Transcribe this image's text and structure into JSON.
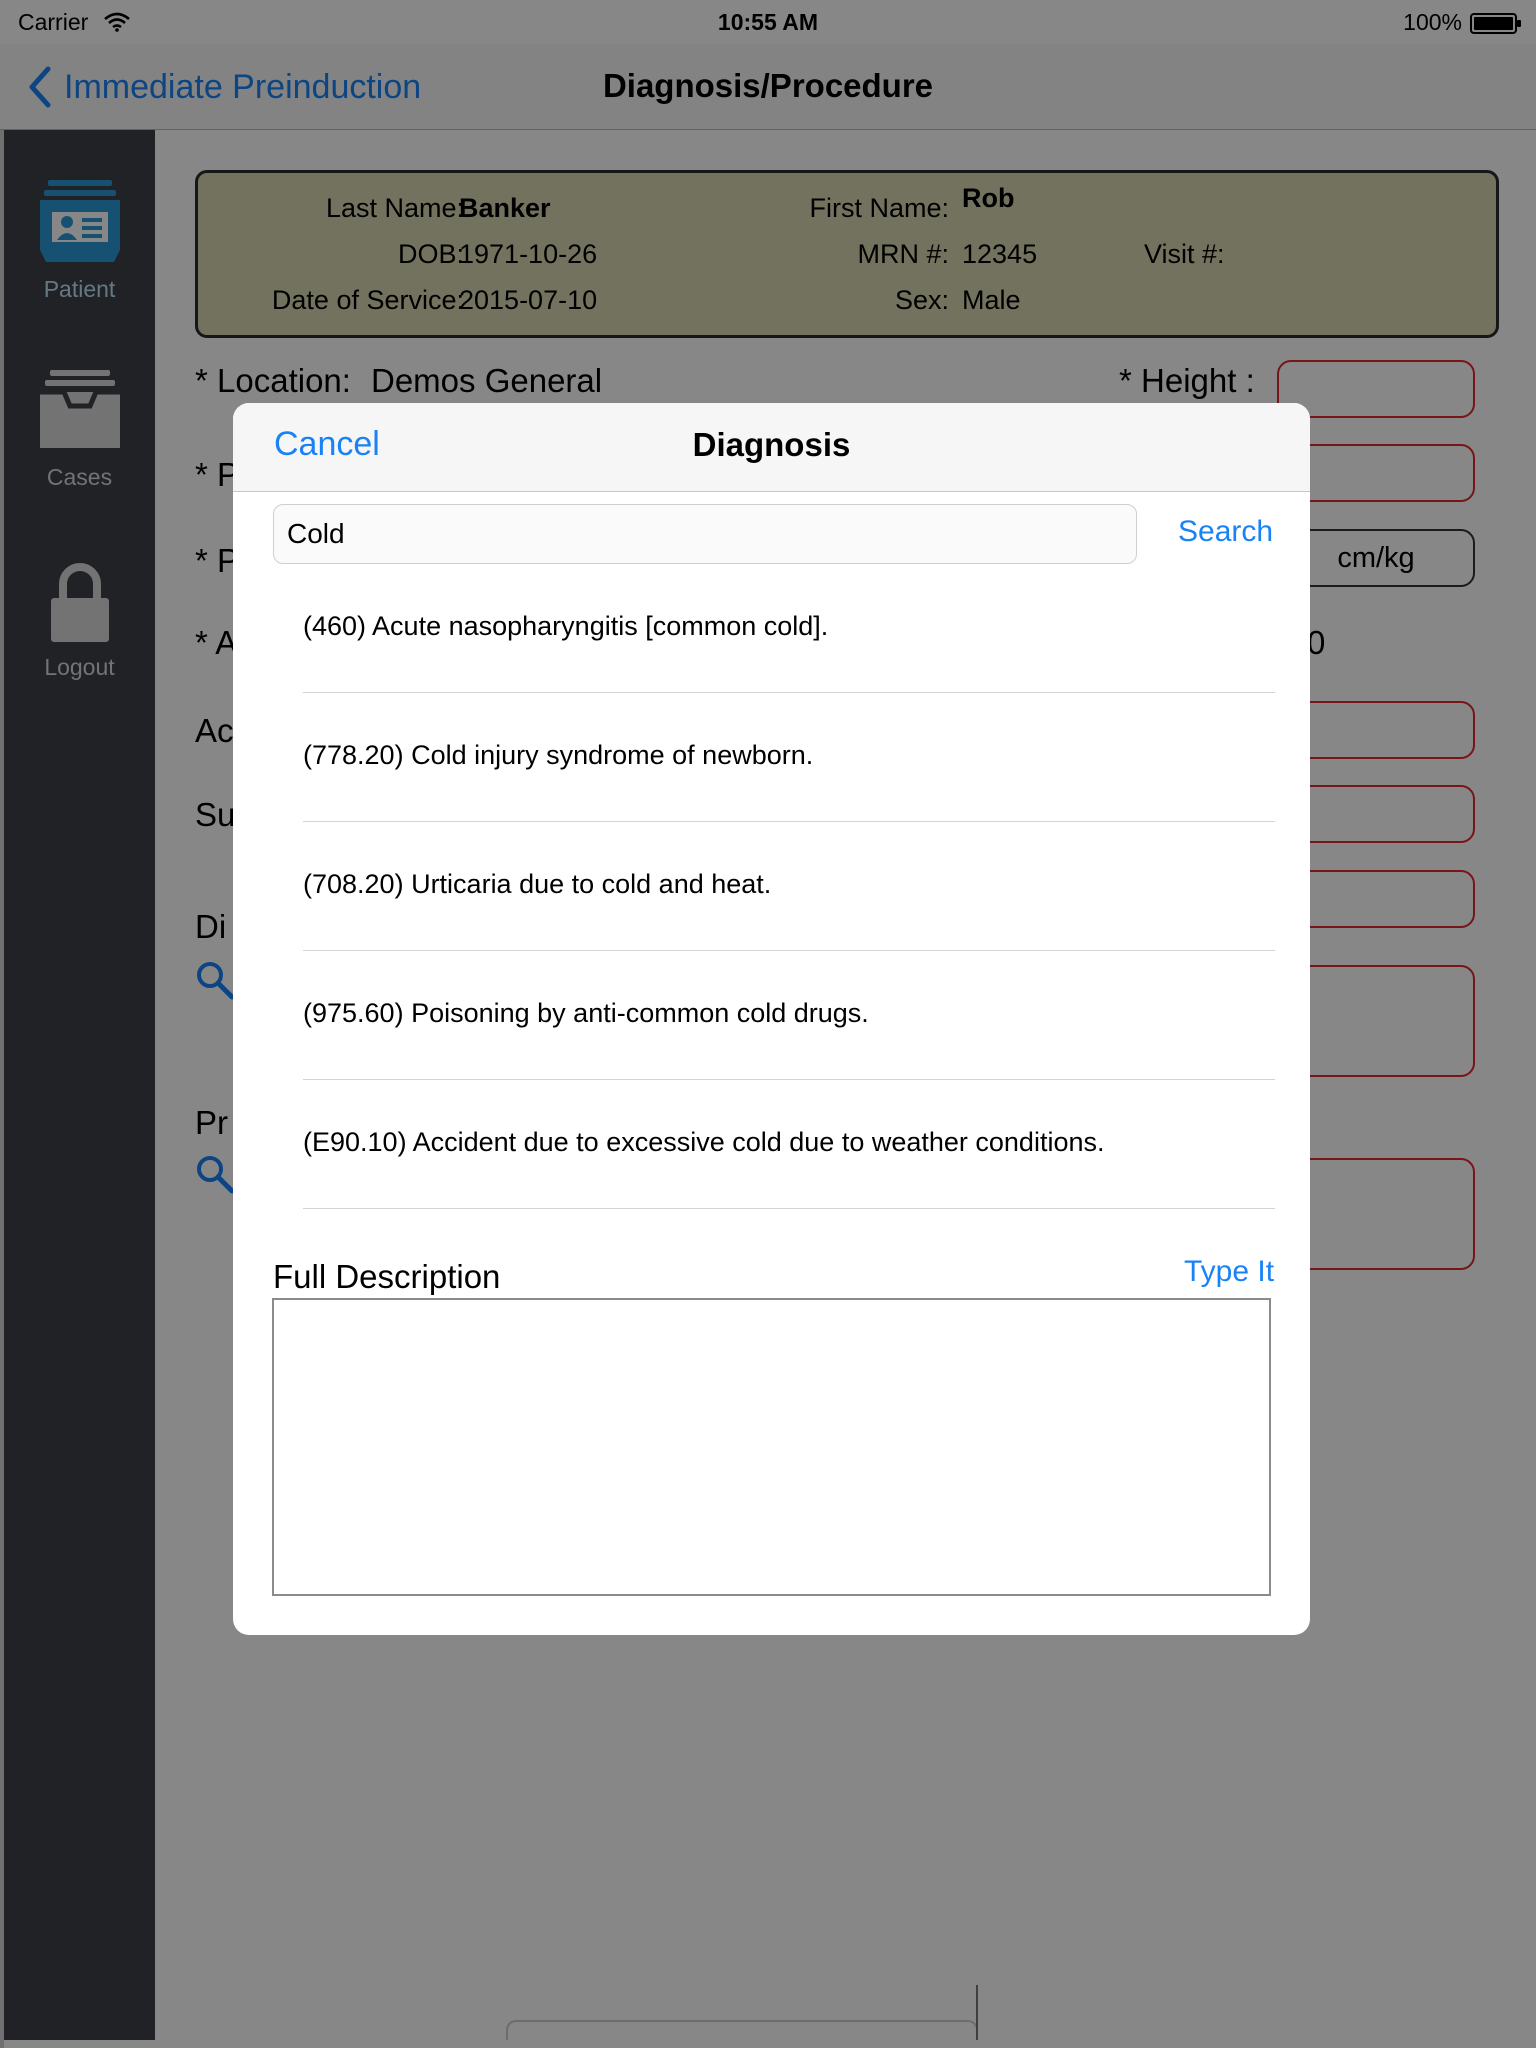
{
  "status_bar": {
    "carrier": "Carrier",
    "time": "10:55 AM",
    "battery": "100%"
  },
  "navbar": {
    "back_label": "Immediate Preinduction",
    "title": "Diagnosis/Procedure"
  },
  "sidebar": {
    "items": [
      {
        "label": "Patient",
        "icon": "patient-card-icon"
      },
      {
        "label": "Cases",
        "icon": "inbox-tray-icon"
      },
      {
        "label": "Logout",
        "icon": "lock-icon"
      }
    ]
  },
  "patient": {
    "last_name_label": "Last Name:",
    "last_name": "Banker",
    "first_name_label": "First Name:",
    "first_name": "Rob",
    "dob_label": "DOB:",
    "dob": "1971-10-26",
    "mrn_label": "MRN #:",
    "mrn": "12345",
    "visit_label": "Visit #:",
    "visit": "",
    "dos_label": "Date of Service:",
    "dos": "2015-07-10",
    "sex_label": "Sex:",
    "sex": "Male"
  },
  "form": {
    "location_label": "* Location:",
    "location_value": "Demos General",
    "height_label": "* Height :",
    "partial_labels": [
      "* P",
      "* P",
      "* A",
      "Ac",
      "Su",
      "Di",
      "Pr"
    ],
    "unit_toggle": "cm/kg",
    "peek_char": "0"
  },
  "modal": {
    "cancel_label": "Cancel",
    "title": "Diagnosis",
    "search_value": "Cold",
    "search_button": "Search",
    "results": [
      "(460) Acute nasopharyngitis [common cold].",
      "(778.20) Cold injury syndrome of newborn.",
      "(708.20) Urticaria due to cold and heat.",
      "(975.60) Poisoning by anti-common cold drugs.",
      "(E90.10) Accident due to excessive cold due to weather conditions."
    ],
    "full_description_label": "Full Description",
    "type_it_label": "Type It",
    "full_description_value": ""
  },
  "colors": {
    "accent": "#1a82f7",
    "sidebar": "#3e4149",
    "patient_card": "#d8d7b3",
    "required_border": "#e0282e",
    "sidebar_icon_active": "#2b9ad8"
  }
}
